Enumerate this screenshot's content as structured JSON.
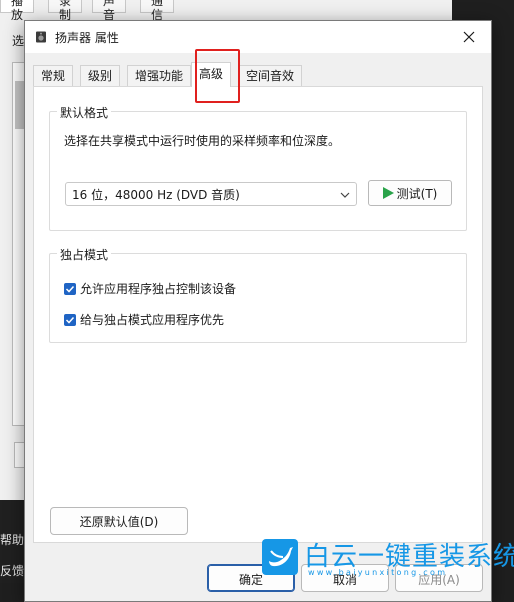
{
  "background_window": {
    "tabs": [
      "播放",
      "录制",
      "声音",
      "通信"
    ],
    "select_label": "选",
    "side_texts": [
      "帮助",
      "反馈"
    ]
  },
  "dialog": {
    "title": "扬声器 属性",
    "close_icon": "close-icon",
    "tabs": [
      {
        "label": "常规",
        "active": false
      },
      {
        "label": "级别",
        "active": false
      },
      {
        "label": "增强功能",
        "active": false
      },
      {
        "label": "高级",
        "active": true
      },
      {
        "label": "空间音效",
        "active": false
      }
    ],
    "highlight_color": "#e0201e",
    "default_format": {
      "group_label": "默认格式",
      "description": "选择在共享模式中运行时使用的采样频率和位深度。",
      "selected_format": "16 位，48000 Hz (DVD 音质)",
      "test_button": "测试(T)"
    },
    "exclusive_mode": {
      "group_label": "独占模式",
      "options": [
        {
          "label": "允许应用程序独占控制该设备",
          "checked": true
        },
        {
          "label": "给与独占模式应用程序优先",
          "checked": true
        }
      ]
    },
    "restore_button": "还原默认值(D)",
    "buttons": {
      "ok": "确定",
      "cancel": "取消",
      "apply": "应用(A)"
    }
  },
  "watermark": {
    "title": "白云一键重装系统",
    "url": "www.baiyunxitong.com",
    "color": "#1697e6"
  }
}
